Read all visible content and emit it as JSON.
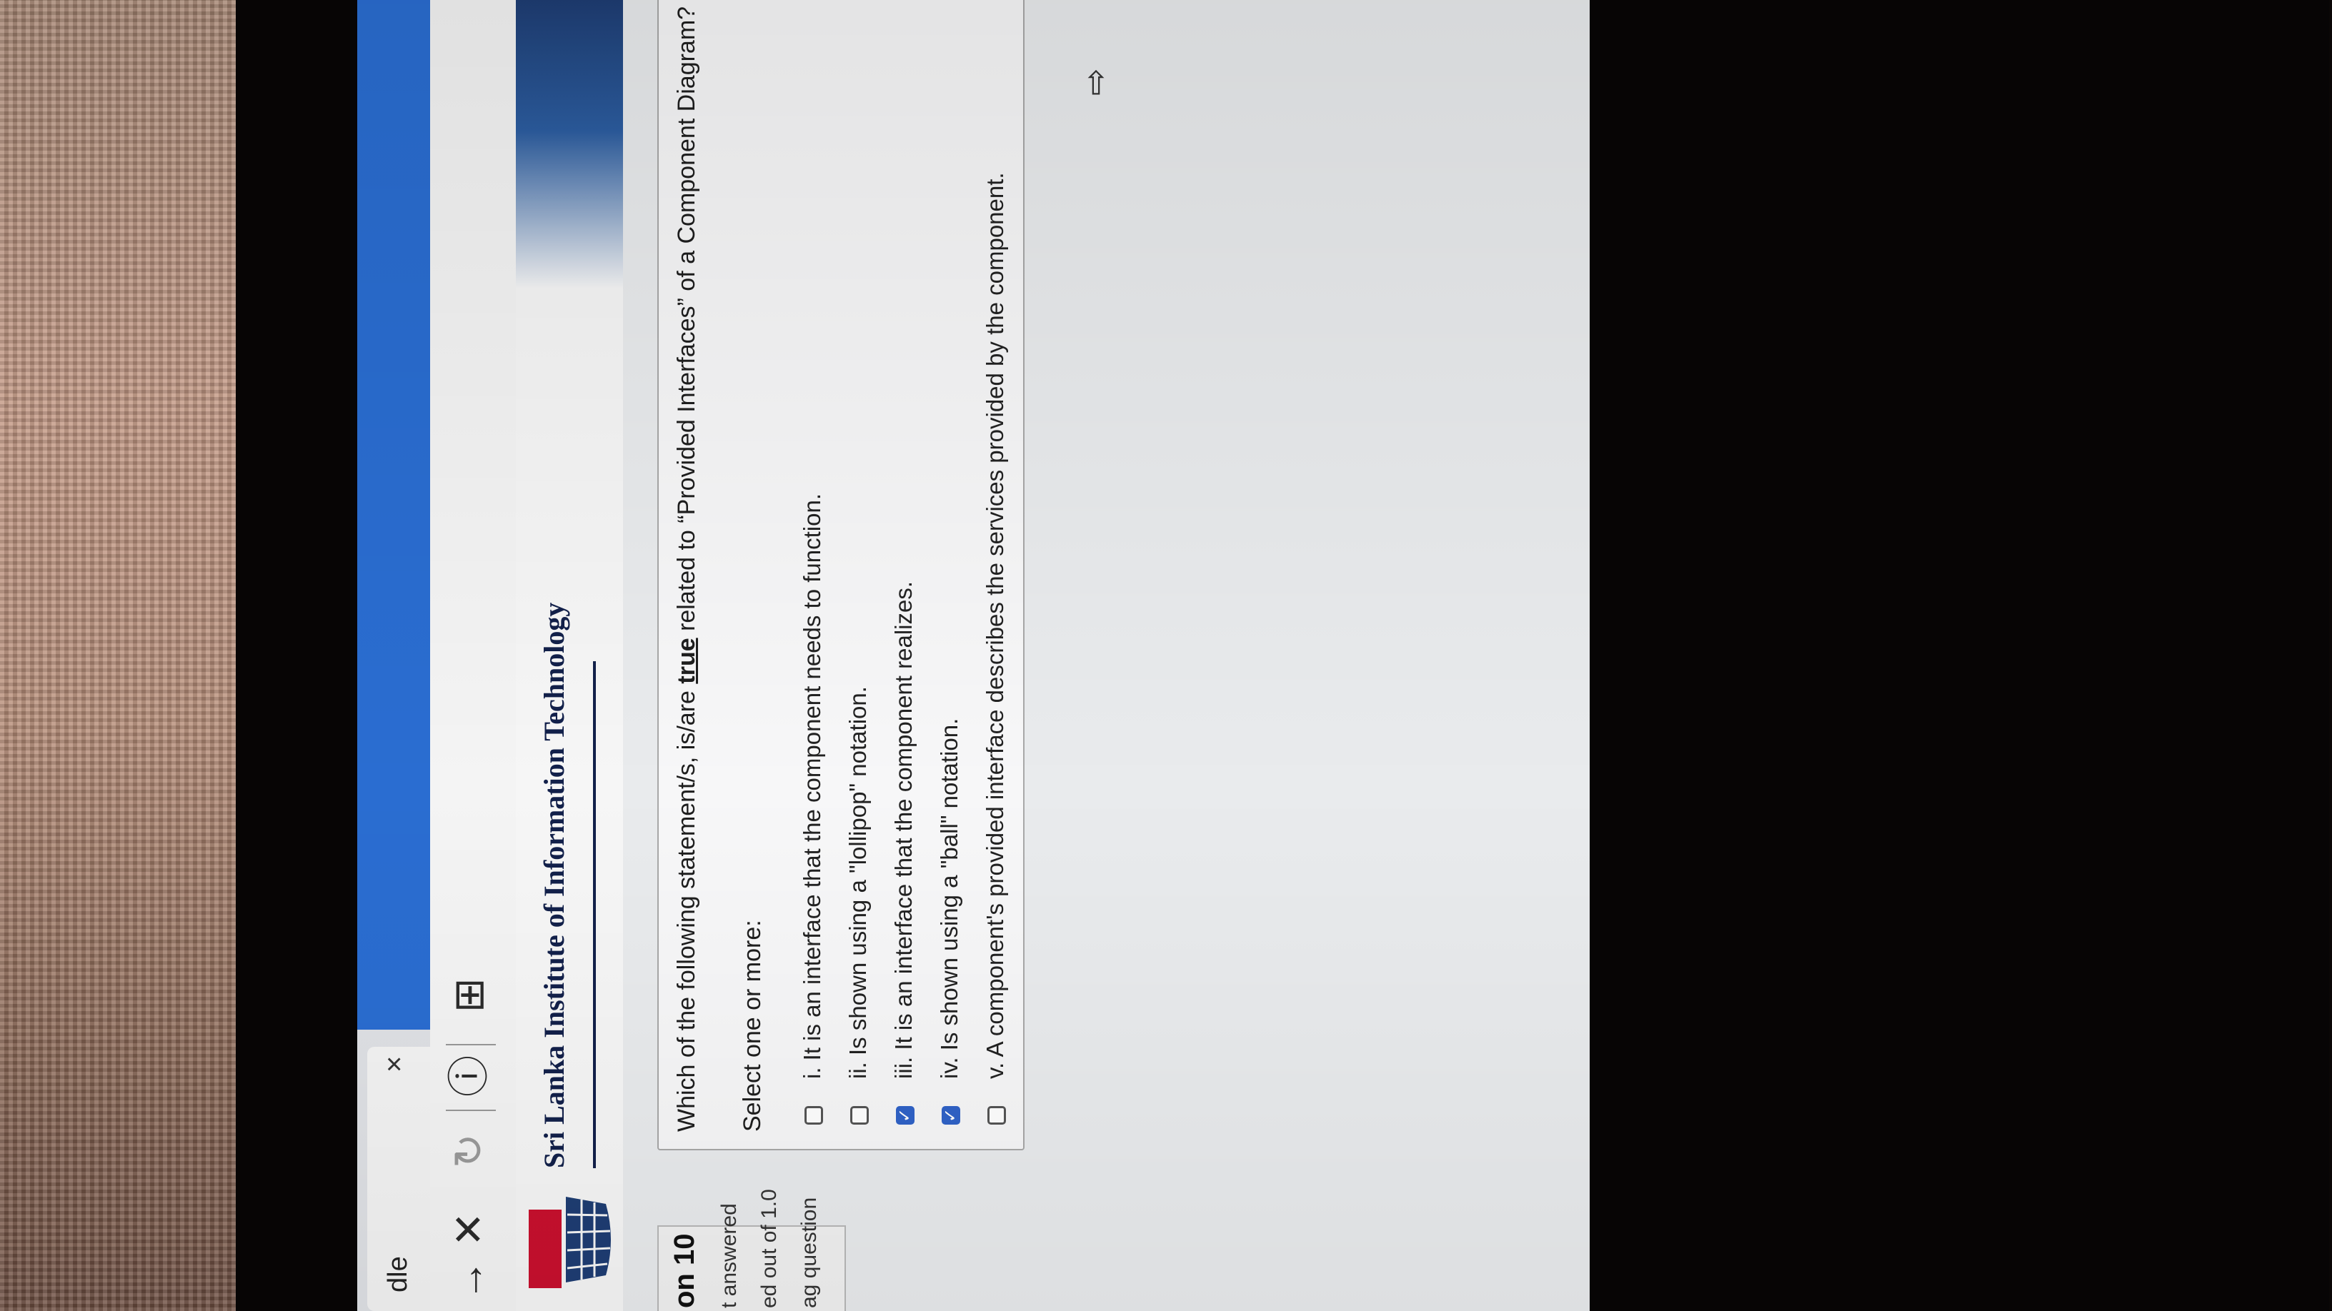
{
  "browser": {
    "tab_title": "dle",
    "tab_close": "×",
    "nav": {
      "forward": "→",
      "stop": "✕",
      "reload": "↻",
      "info": "ⓘ",
      "add_tab": "⊞"
    }
  },
  "header": {
    "logo_text": "SLIIT",
    "site_title": "Sri Lanka Institute of Information Technology"
  },
  "info_panel": {
    "question_number": "on 10",
    "status": "t answered",
    "marks": "ed out of 1.0",
    "flag": "ag question"
  },
  "question": {
    "text_before": "Which of the following statement/s, is/are ",
    "text_emphasis": "true",
    "text_after": " related to “Provided Interfaces” of a Component Diagram?",
    "select_prompt": "Select one or more:",
    "options": [
      {
        "label": "i. It is an interface that the component needs to function.",
        "checked": false
      },
      {
        "label": "ii. Is shown using a \"lollipop\" notation.",
        "checked": false
      },
      {
        "label": "iii. It is an interface that the component realizes.",
        "checked": true
      },
      {
        "label": "iv. Is shown using a \"ball\" notation.",
        "checked": true
      },
      {
        "label": "v. A component's provided interface describes the services provided by the component.",
        "checked": false
      }
    ]
  },
  "icons": {
    "checkmark": "✓",
    "cursor": "⇧"
  },
  "colors": {
    "tab_accent": "#2a6dd1",
    "header_navy": "#12204a",
    "checkbox_checked": "#2f62c7"
  }
}
